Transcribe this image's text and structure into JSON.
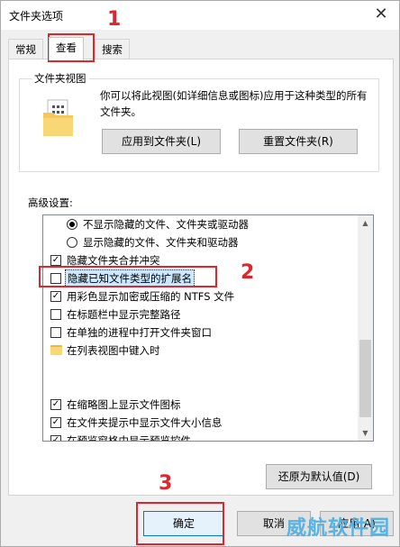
{
  "window": {
    "title": "文件夹选项",
    "close_glyph": "✕"
  },
  "tabs": [
    {
      "label": "常规"
    },
    {
      "label": "查看"
    },
    {
      "label": "搜索"
    }
  ],
  "folder_views": {
    "legend": "文件夹视图",
    "description": "你可以将此视图(如详细信息或图标)应用于这种类型的所有文件夹。",
    "apply_button": "应用到文件夹(L)",
    "reset_button": "重置文件夹(R)"
  },
  "advanced": {
    "label": "高级设置:",
    "items": [
      {
        "type": "radio",
        "checked": true,
        "label": "不显示隐藏的文件、文件夹或驱动器"
      },
      {
        "type": "radio",
        "checked": false,
        "label": "显示隐藏的文件、文件夹和驱动器"
      },
      {
        "type": "check",
        "checked": true,
        "label": "隐藏文件夹合并冲突"
      },
      {
        "type": "check",
        "checked": false,
        "label": "隐藏已知文件类型的扩展名"
      },
      {
        "type": "check",
        "checked": true,
        "label": "用彩色显示加密或压缩的 NTFS 文件"
      },
      {
        "type": "check",
        "checked": false,
        "label": "在标题栏中显示完整路径"
      },
      {
        "type": "check",
        "checked": false,
        "label": "在单独的进程中打开文件夹窗口"
      },
      {
        "type": "folder",
        "label": "在列表视图中键入时"
      },
      {
        "type": "check",
        "checked": true,
        "label": "在缩略图上显示文件图标"
      },
      {
        "type": "check",
        "checked": true,
        "label": "在文件夹提示中显示文件大小信息"
      },
      {
        "type": "check",
        "checked": true,
        "label": "在预览窗格中显示预览控件"
      }
    ]
  },
  "restore_button": "还原为默认值(D)",
  "ok_button": "确定",
  "cancel_button": "取消",
  "apply_button": "应用(A)",
  "check_glyph": "✓",
  "annotations": {
    "one": "1",
    "two": "2",
    "three": "3",
    "color": "#e0262d"
  },
  "watermark": "威航软件园"
}
